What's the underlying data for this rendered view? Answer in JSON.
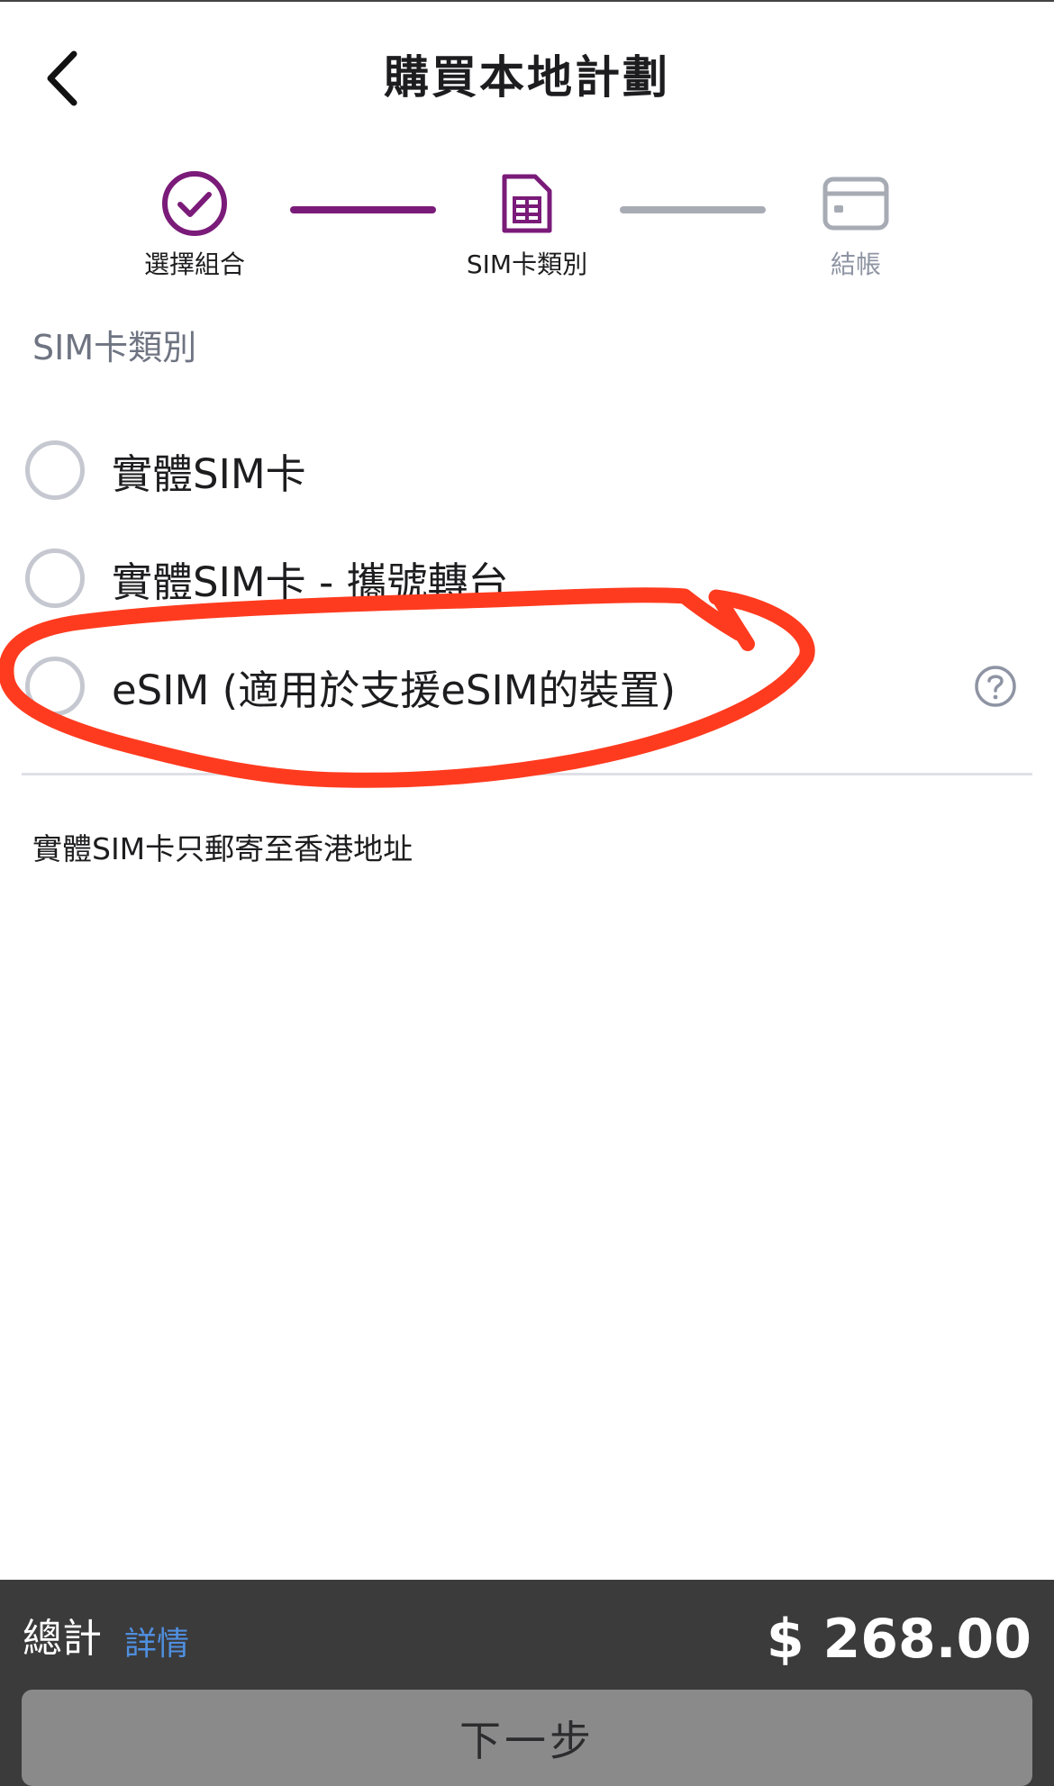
{
  "header": {
    "title": "購買本地計劃",
    "back_icon": "chevron-left-icon"
  },
  "stepper": {
    "steps": [
      {
        "label": "選擇組合",
        "icon": "check-circle-icon",
        "state": "completed"
      },
      {
        "label": "SIM卡類別",
        "icon": "sim-card-icon",
        "state": "active"
      },
      {
        "label": "結帳",
        "icon": "credit-card-icon",
        "state": "pending"
      }
    ],
    "colors": {
      "active": "#7a1b79",
      "pending": "#a7abb4"
    }
  },
  "section": {
    "title": "SIM卡類別"
  },
  "options": [
    {
      "label": "實體SIM卡",
      "selected": false
    },
    {
      "label": "實體SIM卡 - 攜號轉台",
      "selected": false
    },
    {
      "label": "eSIM (適用於支援eSIM的裝置)",
      "selected": false,
      "help_icon": "question-circle-icon"
    }
  ],
  "note": "實體SIM卡只郵寄至香港地址",
  "annotation": {
    "type": "hand-drawn-circle",
    "color": "#ff3b1f"
  },
  "footer": {
    "total_label": "總計",
    "details_link": "詳情",
    "price": "$ 268.00",
    "next_button": "下一步"
  }
}
